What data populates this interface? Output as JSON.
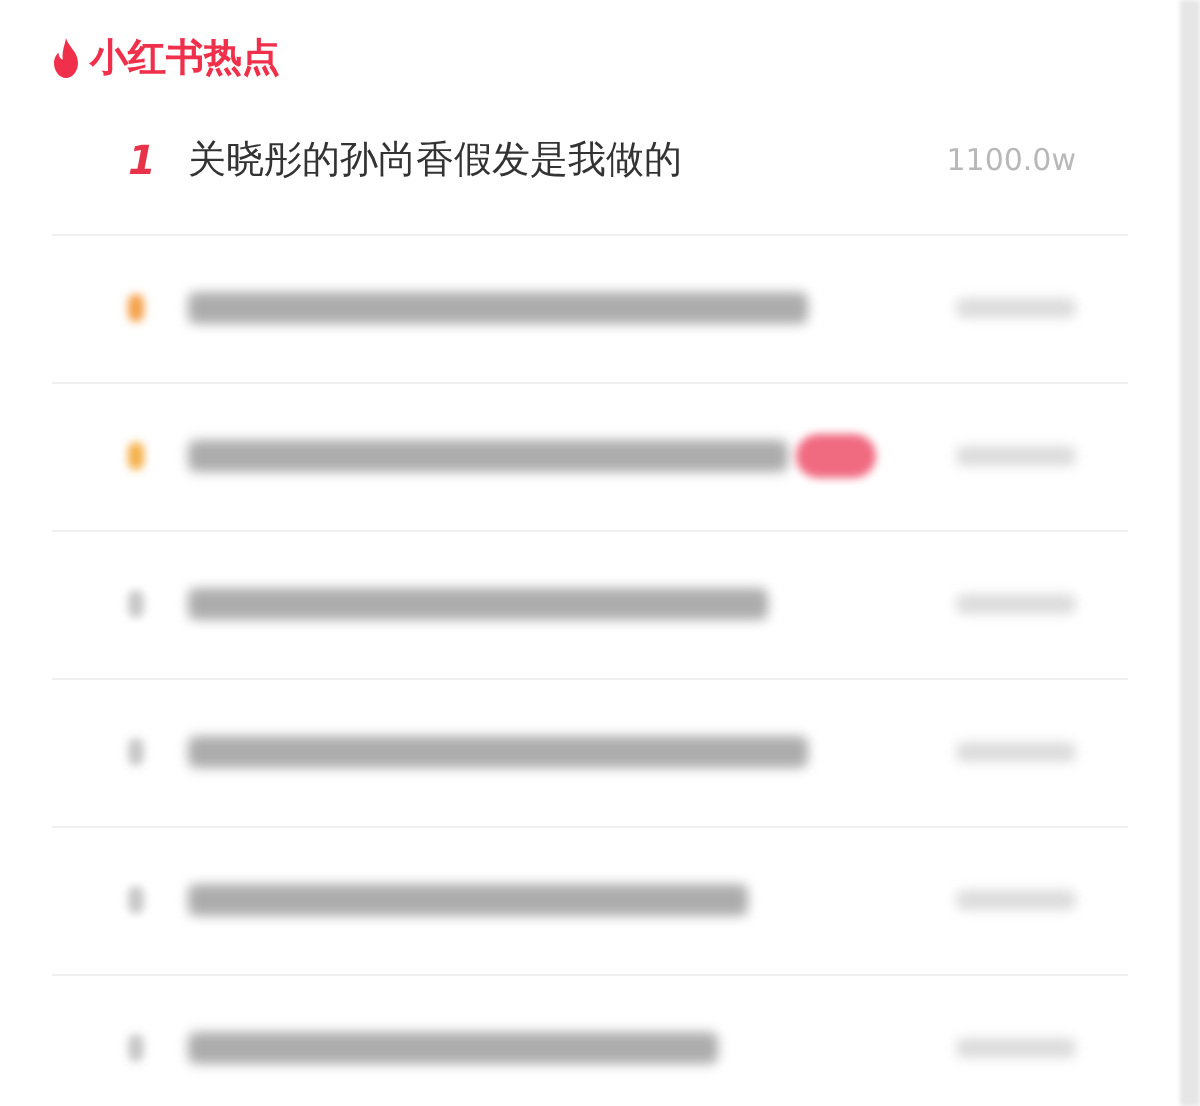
{
  "header": {
    "title": "小红书热点"
  },
  "rows": [
    {
      "kind": "text",
      "rank": "1",
      "title": "关晓彤的孙尚香假发是我做的",
      "heat": "1100.0w"
    },
    {
      "kind": "blurred",
      "color": "#f5a14a",
      "badge": false
    },
    {
      "kind": "blurred",
      "color": "#f5b04a",
      "badge": true
    },
    {
      "kind": "blurred",
      "color": "#c8c8c8",
      "badge": false
    },
    {
      "kind": "blurred",
      "color": "#c8c8c8",
      "badge": false
    },
    {
      "kind": "blurred",
      "color": "#c8c8c8",
      "badge": false
    },
    {
      "kind": "blurred",
      "color": "#c8c8c8",
      "badge": false
    }
  ]
}
